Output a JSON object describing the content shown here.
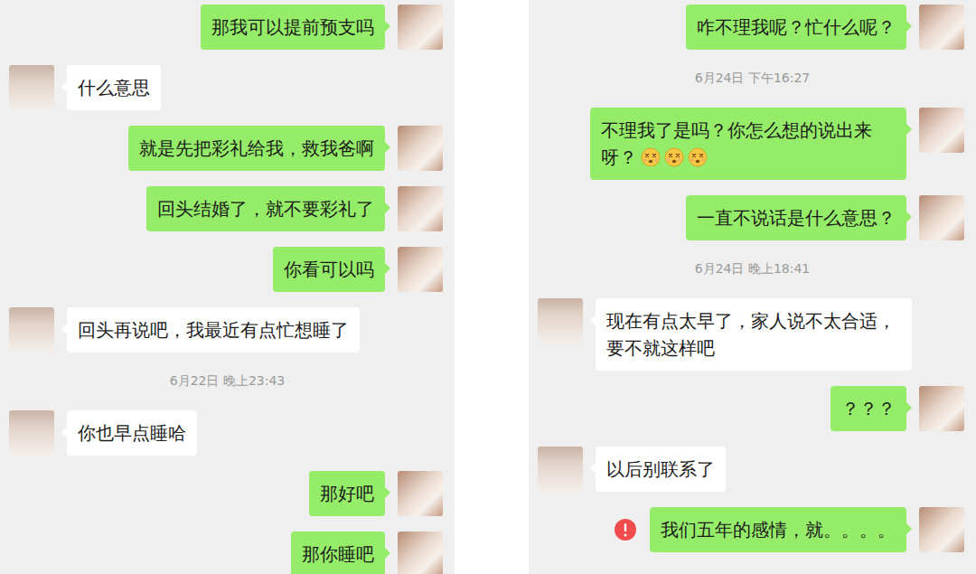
{
  "panels": [
    {
      "messages": [
        {
          "kind": "sent",
          "text": "那我可以提前预支吗",
          "failed": false,
          "emoji_count": 0
        },
        {
          "kind": "received",
          "text": "什么意思",
          "failed": false,
          "emoji_count": 0
        },
        {
          "kind": "sent",
          "text": "就是先把彩礼给我，救我爸啊",
          "failed": false,
          "emoji_count": 0
        },
        {
          "kind": "sent",
          "text": "回头结婚了，就不要彩礼了",
          "failed": false,
          "emoji_count": 0
        },
        {
          "kind": "sent",
          "text": "你看可以吗",
          "failed": false,
          "emoji_count": 0
        },
        {
          "kind": "received",
          "text": "回头再说吧，我最近有点忙想睡了",
          "failed": false,
          "emoji_count": 0
        },
        {
          "kind": "timestamp",
          "text": "6月22日 晚上23:43"
        },
        {
          "kind": "received",
          "text": "你也早点睡哈",
          "failed": false,
          "emoji_count": 0
        },
        {
          "kind": "sent",
          "text": "那好吧",
          "failed": false,
          "emoji_count": 0
        },
        {
          "kind": "sent",
          "text": "那你睡吧",
          "failed": false,
          "emoji_count": 0
        }
      ]
    },
    {
      "messages": [
        {
          "kind": "sent",
          "text": "咋不理我呢？忙什么呢？",
          "failed": false,
          "emoji_count": 0
        },
        {
          "kind": "timestamp",
          "text": "6月24日 下午16:27"
        },
        {
          "kind": "sent",
          "text": "不理我了是吗？你怎么想的说出来呀？",
          "failed": false,
          "emoji_count": 3
        },
        {
          "kind": "sent",
          "text": "一直不说话是什么意思？",
          "failed": false,
          "emoji_count": 0
        },
        {
          "kind": "timestamp",
          "text": "6月24日 晚上18:41"
        },
        {
          "kind": "received",
          "text": "现在有点太早了，家人说不太合适，要不就这样吧",
          "failed": false,
          "emoji_count": 0
        },
        {
          "kind": "sent",
          "text": "？？？",
          "failed": false,
          "emoji_count": 0
        },
        {
          "kind": "received",
          "text": "以后别联系了",
          "failed": false,
          "emoji_count": 0
        },
        {
          "kind": "sent",
          "text": "我们五年的感情，就。。。。",
          "failed": true,
          "emoji_count": 0
        }
      ]
    }
  ]
}
